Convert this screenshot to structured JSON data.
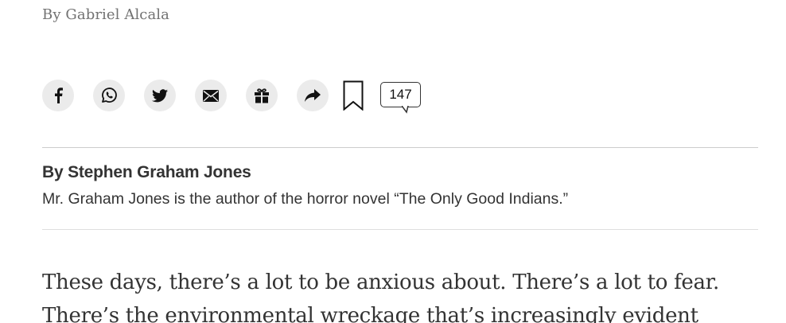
{
  "photo_credit": "By Gabriel Alcala",
  "share": {
    "buttons": [
      {
        "name": "facebook",
        "icon": "facebook-icon"
      },
      {
        "name": "whatsapp",
        "icon": "whatsapp-icon"
      },
      {
        "name": "twitter",
        "icon": "twitter-icon"
      },
      {
        "name": "email",
        "icon": "email-icon"
      },
      {
        "name": "gift",
        "icon": "gift-icon"
      },
      {
        "name": "share",
        "icon": "share-arrow-icon"
      }
    ],
    "bookmark_icon": "bookmark-icon",
    "comment_count": "147"
  },
  "byline": {
    "author": "By Stephen Graham Jones",
    "bio": "Mr. Graham Jones is the author of the horror novel “The Only Good Indians.”"
  },
  "article": {
    "paragraphs": [
      "These days, there’s a lot to be anxious about. There’s a lot to fear. There’s the environmental wreckage that’s increasingly evident"
    ]
  },
  "colors": {
    "button_bg": "#ebebeb",
    "text": "#333333",
    "credit": "#727272",
    "rule": "#cccccc"
  }
}
